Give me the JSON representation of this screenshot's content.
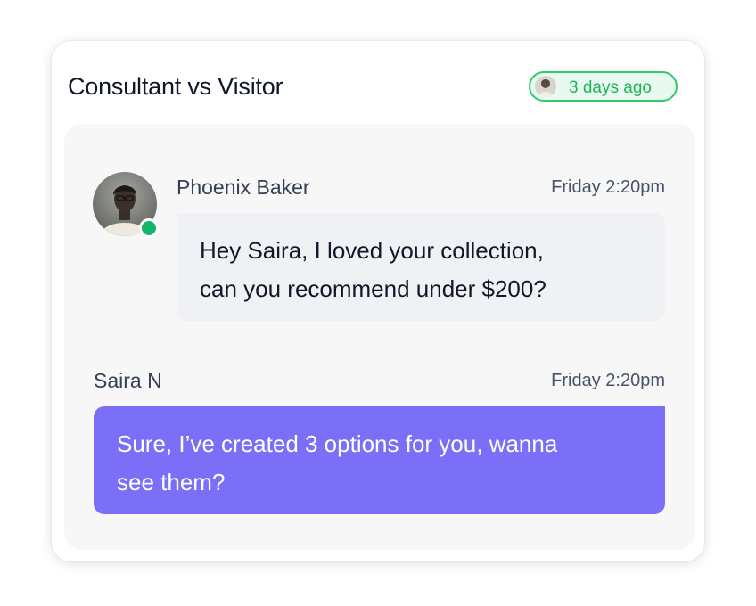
{
  "card": {
    "title": "Consultant vs Visitor",
    "badge": {
      "text": "3 days ago",
      "color": "#22b45c"
    }
  },
  "messages": [
    {
      "sender": "Phoenix Baker",
      "time": "Friday 2:20pm",
      "text": "Hey Saira, I loved your collection,\ncan you recommend under $200?",
      "online": true,
      "avatar_icon": "user-avatar"
    },
    {
      "sender": "Saira N",
      "time": "Friday 2:20pm",
      "text": "Sure, I’ve created 3 options for you, wanna\nsee them?",
      "bubble_color": "#7a6ff6"
    }
  ],
  "colors": {
    "online": "#12b76a",
    "received_bubble": "#f0f1f4",
    "sent_bubble": "#7a6ff6"
  }
}
